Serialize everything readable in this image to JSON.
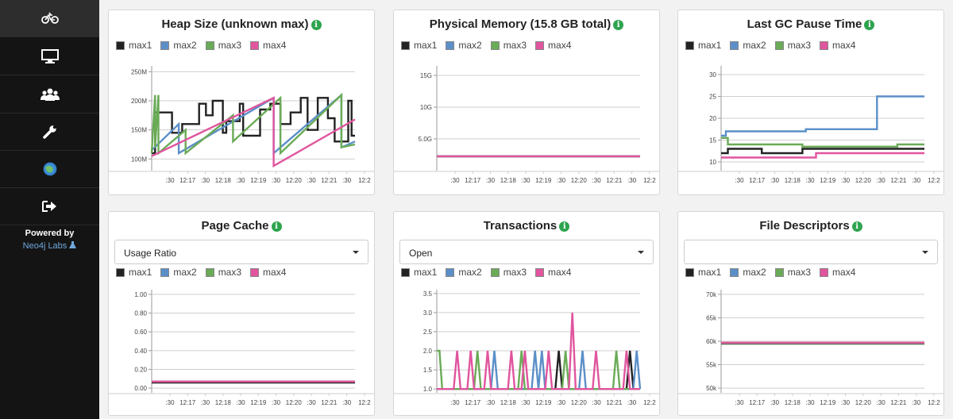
{
  "sidebar": {
    "items": [
      {
        "icon": "bicycle-icon",
        "active": true
      },
      {
        "icon": "monitor-icon",
        "active": false
      },
      {
        "icon": "users-icon",
        "active": false
      },
      {
        "icon": "wrench-icon",
        "active": false
      },
      {
        "icon": "neo4j-logo-icon",
        "active": false
      },
      {
        "icon": "sign-out-icon",
        "active": false
      }
    ],
    "powered_by": "Powered by",
    "labs_link": "Neo4j Labs",
    "labs_icon": "flask-icon"
  },
  "legend": [
    "max1",
    "max2",
    "max3",
    "max4"
  ],
  "colors": {
    "max1": "#222222",
    "max2": "#5b8fc8",
    "max3": "#6aab57",
    "max4": "#e0559e"
  },
  "x_ticks": [
    ":30",
    "12:17",
    ":30",
    "12:18",
    ":30",
    "12:19",
    ":30",
    "12:20",
    ":30",
    "12:21",
    ":30",
    "12:2"
  ],
  "panels": {
    "heap": {
      "title": "Heap Size (unknown max)"
    },
    "memory": {
      "title": "Physical Memory (15.8 GB total)"
    },
    "gc": {
      "title": "Last GC Pause Time"
    },
    "pagecache": {
      "title": "Page Cache",
      "selected": "Usage Ratio"
    },
    "tx": {
      "title": "Transactions",
      "selected": "Open"
    },
    "fd": {
      "title": "File Descriptors",
      "selected": ""
    }
  },
  "chart_data": [
    {
      "panel": "heap",
      "type": "line",
      "y_ticks": [
        "250M",
        "200M",
        "150M",
        "100M"
      ],
      "y_tick_values": [
        250,
        200,
        150,
        100
      ],
      "ylim": [
        80,
        260
      ],
      "series": [
        {
          "name": "max1",
          "x": [
            0,
            0.5,
            0.5,
            3,
            3,
            4.5,
            4.5,
            7,
            7,
            8,
            8,
            9,
            9,
            10.5,
            10.5,
            11,
            11,
            13,
            13,
            13.5,
            13.5,
            16,
            16,
            17.5,
            17.5,
            19,
            19,
            20.5,
            20.5,
            22,
            22,
            23,
            23,
            24.5,
            24.5,
            26,
            26,
            27,
            27,
            29,
            29,
            29.5,
            29.5,
            30
          ],
          "y": [
            110,
            110,
            180,
            180,
            145,
            145,
            160,
            160,
            195,
            195,
            175,
            175,
            200,
            200,
            145,
            145,
            165,
            165,
            195,
            195,
            140,
            140,
            185,
            185,
            195,
            195,
            160,
            160,
            180,
            180,
            205,
            205,
            150,
            150,
            205,
            205,
            170,
            170,
            130,
            130,
            200,
            200,
            140,
            140
          ]
        },
        {
          "name": "max2",
          "x": [
            0,
            4,
            4,
            18,
            18,
            28,
            28,
            30
          ],
          "y": [
            115,
            160,
            110,
            205,
            110,
            210,
            120,
            130
          ]
        },
        {
          "name": "max3",
          "x": [
            0,
            0.5,
            0.5,
            1,
            1,
            5,
            5,
            12,
            12,
            19,
            19,
            28,
            28,
            30
          ],
          "y": [
            110,
            210,
            120,
            210,
            110,
            150,
            110,
            175,
            130,
            205,
            110,
            210,
            120,
            125
          ]
        },
        {
          "name": "max4",
          "x": [
            0,
            18,
            18,
            30
          ],
          "y": [
            105,
            205,
            88,
            168
          ]
        }
      ]
    },
    {
      "panel": "memory",
      "type": "line",
      "y_ticks": [
        "15G",
        "10G",
        "5.0G"
      ],
      "y_tick_values": [
        15,
        10,
        5
      ],
      "ylim": [
        0,
        16.5
      ],
      "series": [
        {
          "name": "max1",
          "x": [
            0,
            30
          ],
          "y": [
            2.25,
            2.25
          ]
        },
        {
          "name": "max2",
          "x": [
            0,
            30
          ],
          "y": [
            2.25,
            2.25
          ]
        },
        {
          "name": "max3",
          "x": [
            0,
            30
          ],
          "y": [
            2.25,
            2.25
          ]
        },
        {
          "name": "max4",
          "x": [
            0,
            30
          ],
          "y": [
            2.25,
            2.25
          ]
        }
      ]
    },
    {
      "panel": "gc",
      "type": "line",
      "y_ticks": [
        "30",
        "25",
        "20",
        "15",
        "10"
      ],
      "y_tick_values": [
        30,
        25,
        20,
        15,
        10
      ],
      "ylim": [
        8,
        32
      ],
      "series": [
        {
          "name": "max1",
          "x": [
            0,
            1,
            1,
            6,
            6,
            12,
            12,
            30
          ],
          "y": [
            12,
            12,
            13,
            13,
            12,
            12,
            13,
            13
          ]
        },
        {
          "name": "max2",
          "x": [
            0,
            0.7,
            0.7,
            12.5,
            12.5,
            23,
            23,
            30
          ],
          "y": [
            16,
            16,
            17,
            17,
            17.5,
            17.5,
            25,
            25
          ]
        },
        {
          "name": "max3",
          "x": [
            0,
            1,
            1,
            12,
            12,
            26,
            26,
            30
          ],
          "y": [
            15.5,
            15.5,
            14,
            14,
            13.5,
            13.5,
            14,
            14
          ]
        },
        {
          "name": "max4",
          "x": [
            0,
            14,
            14,
            30
          ],
          "y": [
            11,
            11,
            12,
            12
          ]
        }
      ]
    },
    {
      "panel": "pagecache",
      "type": "line",
      "y_ticks": [
        "1.00",
        "0.80",
        "0.60",
        "0.40",
        "0.20",
        "0.00"
      ],
      "y_tick_values": [
        1,
        0.8,
        0.6,
        0.4,
        0.2,
        0
      ],
      "ylim": [
        -0.05,
        1.05
      ],
      "series": [
        {
          "name": "max1",
          "x": [
            0,
            30
          ],
          "y": [
            0.06,
            0.06
          ]
        },
        {
          "name": "max2",
          "x": [
            0,
            30
          ],
          "y": [
            0.07,
            0.07
          ]
        },
        {
          "name": "max3",
          "x": [
            0,
            30
          ],
          "y": [
            0.07,
            0.07
          ]
        },
        {
          "name": "max4",
          "x": [
            0,
            30
          ],
          "y": [
            0.07,
            0.07
          ]
        }
      ]
    },
    {
      "panel": "tx",
      "type": "line",
      "y_ticks": [
        "3.5",
        "3.0",
        "2.5",
        "2.0",
        "1.5",
        "1.0"
      ],
      "y_tick_values": [
        3.5,
        3,
        2.5,
        2,
        1.5,
        1
      ],
      "ylim": [
        0.9,
        3.6
      ],
      "series": [
        {
          "name": "max1",
          "x": [
            0,
            17.5,
            18,
            18.5,
            28,
            28.5,
            29,
            30
          ],
          "y": [
            1,
            1,
            2,
            1,
            1,
            2,
            1,
            1
          ]
        },
        {
          "name": "max2",
          "x": [
            0,
            8,
            8.5,
            9,
            14,
            14.5,
            15,
            15.5,
            16,
            16.5,
            21,
            21.5,
            22,
            29,
            29.5,
            30
          ],
          "y": [
            1,
            1,
            2,
            1,
            1,
            2,
            1,
            2,
            1,
            1,
            1,
            2,
            1,
            1,
            2,
            1
          ]
        },
        {
          "name": "max3",
          "x": [
            0,
            0.4,
            0.8,
            1.5,
            5.5,
            6,
            6.5,
            12,
            12.5,
            13,
            18.5,
            19,
            19.5,
            26,
            26.5,
            27,
            30
          ],
          "y": [
            2,
            2,
            1,
            1,
            1,
            2,
            1,
            1,
            2,
            1,
            1,
            2,
            1,
            1,
            2,
            1,
            1
          ]
        },
        {
          "name": "max4",
          "x": [
            0,
            2.5,
            3,
            3.5,
            4.5,
            5,
            5.5,
            7,
            7.5,
            8,
            10.5,
            11,
            11.5,
            12.5,
            13,
            13.5,
            16,
            16.5,
            17,
            19.5,
            20,
            20.5,
            23,
            23.5,
            24,
            27.5,
            28,
            28.5,
            30
          ],
          "y": [
            1,
            1,
            2,
            1,
            1,
            2,
            1,
            1,
            2,
            1,
            1,
            2,
            1,
            1,
            2,
            1,
            1,
            2,
            1,
            1,
            3,
            1,
            1,
            2,
            1,
            1,
            2,
            1,
            1
          ]
        }
      ]
    },
    {
      "panel": "fd",
      "type": "line",
      "y_ticks": [
        "70k",
        "65k",
        "60k",
        "55k",
        "50k"
      ],
      "y_tick_values": [
        70,
        65,
        60,
        55,
        50
      ],
      "ylim": [
        49,
        71
      ],
      "series": [
        {
          "name": "max1",
          "x": [
            0,
            30
          ],
          "y": [
            59.5,
            59.5
          ]
        },
        {
          "name": "max2",
          "x": [
            0,
            30
          ],
          "y": [
            59.6,
            59.6
          ]
        },
        {
          "name": "max3",
          "x": [
            0,
            30
          ],
          "y": [
            59.6,
            59.6
          ]
        },
        {
          "name": "max4",
          "x": [
            0,
            30
          ],
          "y": [
            59.7,
            59.7
          ]
        }
      ]
    }
  ]
}
